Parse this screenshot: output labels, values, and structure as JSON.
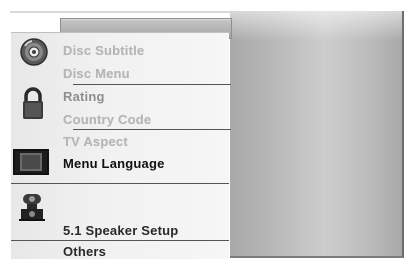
{
  "menu": {
    "items": [
      {
        "label": "Disc Subtitle"
      },
      {
        "label": "Disc Menu"
      },
      {
        "label": "Rating"
      },
      {
        "label": "Country Code"
      },
      {
        "label": "TV Aspect"
      },
      {
        "label": "Menu Language"
      },
      {
        "label": "5.1 Speaker Setup"
      },
      {
        "label": "Others"
      }
    ],
    "selected": "Menu Language"
  },
  "icons": [
    "disc-icon",
    "lock-icon",
    "tv-screen-icon",
    "speaker-icon"
  ],
  "colors": {
    "panel_gray": "#b8b8b8",
    "faded_text": "#b6b6b6",
    "active_text": "#111111"
  }
}
